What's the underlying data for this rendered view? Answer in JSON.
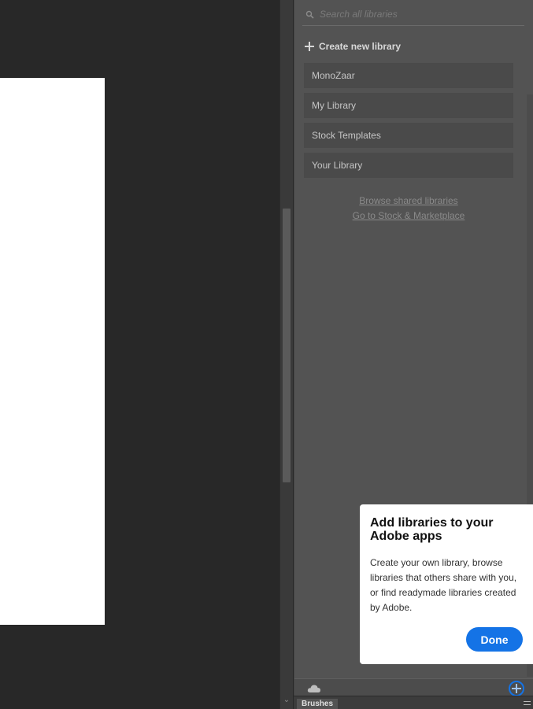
{
  "panel": {
    "search": {
      "placeholder": "Search all libraries"
    },
    "create_label": "Create new library",
    "libraries": [
      {
        "label": "MonoZaar"
      },
      {
        "label": "My Library"
      },
      {
        "label": "Stock Templates"
      },
      {
        "label": "Your Library"
      }
    ],
    "links": {
      "browse_shared": "Browse shared libraries",
      "stock_marketplace": "Go to Stock & Marketplace"
    }
  },
  "popover": {
    "title": "Add libraries to your Adobe apps",
    "body": "Create your own library, browse libraries that others share with you, or find readymade libraries created by Adobe.",
    "done_label": "Done"
  },
  "tabs": {
    "brushes": "Brushes"
  },
  "icons": {
    "search": "search-icon",
    "plus": "plus-icon",
    "cloud": "cloud-icon",
    "add_library": "add-circle-icon",
    "menu": "hamburger-menu-icon",
    "scroll_down": "chevron-down-icon"
  },
  "colors": {
    "accent": "#1473e6",
    "panel_bg": "#535353",
    "canvas_bg": "#282828"
  }
}
